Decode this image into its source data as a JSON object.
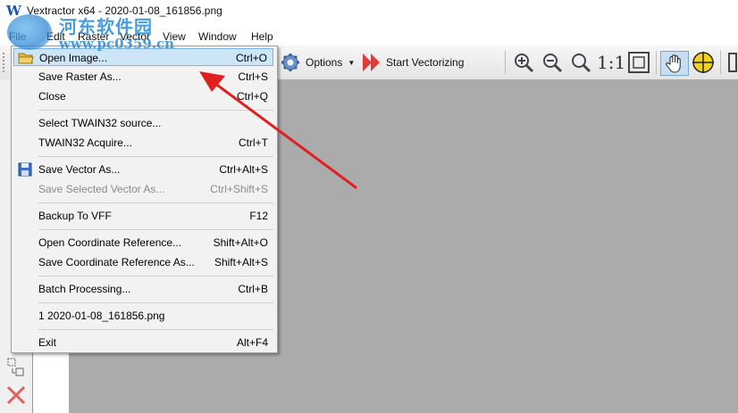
{
  "window": {
    "title": "Vextractor x64 - 2020-01-08_161856.png"
  },
  "watermark": {
    "site_name": "河东软件园",
    "url": "www.pc0359.cn"
  },
  "menubar": {
    "items": [
      "File",
      "Edit",
      "Raster",
      "Vector",
      "View",
      "Window",
      "Help"
    ]
  },
  "toolbar": {
    "options_label": "Options",
    "start_label": "Start Vectorizing",
    "zoom_one_label": "1:1"
  },
  "file_menu": {
    "items": [
      {
        "label": "Open Image...",
        "shortcut": "Ctrl+O"
      },
      {
        "label": "Save Raster As...",
        "shortcut": "Ctrl+S"
      },
      {
        "label": "Close",
        "shortcut": "Ctrl+Q"
      },
      {
        "label": "Select TWAIN32 source...",
        "shortcut": ""
      },
      {
        "label": "TWAIN32 Acquire...",
        "shortcut": "Ctrl+T"
      },
      {
        "label": "Save Vector As...",
        "shortcut": "Ctrl+Alt+S"
      },
      {
        "label": "Save Selected Vector As...",
        "shortcut": "Ctrl+Shift+S"
      },
      {
        "label": "Backup To VFF",
        "shortcut": "F12"
      },
      {
        "label": "Open Coordinate Reference...",
        "shortcut": "Shift+Alt+O"
      },
      {
        "label": "Save Coordinate Reference As...",
        "shortcut": "Shift+Alt+S"
      },
      {
        "label": "Batch Processing...",
        "shortcut": "Ctrl+B"
      },
      {
        "label": "1 2020-01-08_161856.png",
        "shortcut": ""
      },
      {
        "label": "Exit",
        "shortcut": "Alt+F4"
      }
    ]
  },
  "colors": {
    "highlight": "#cde6f7",
    "arrow": "#e02020",
    "canvas": "#ababab"
  }
}
